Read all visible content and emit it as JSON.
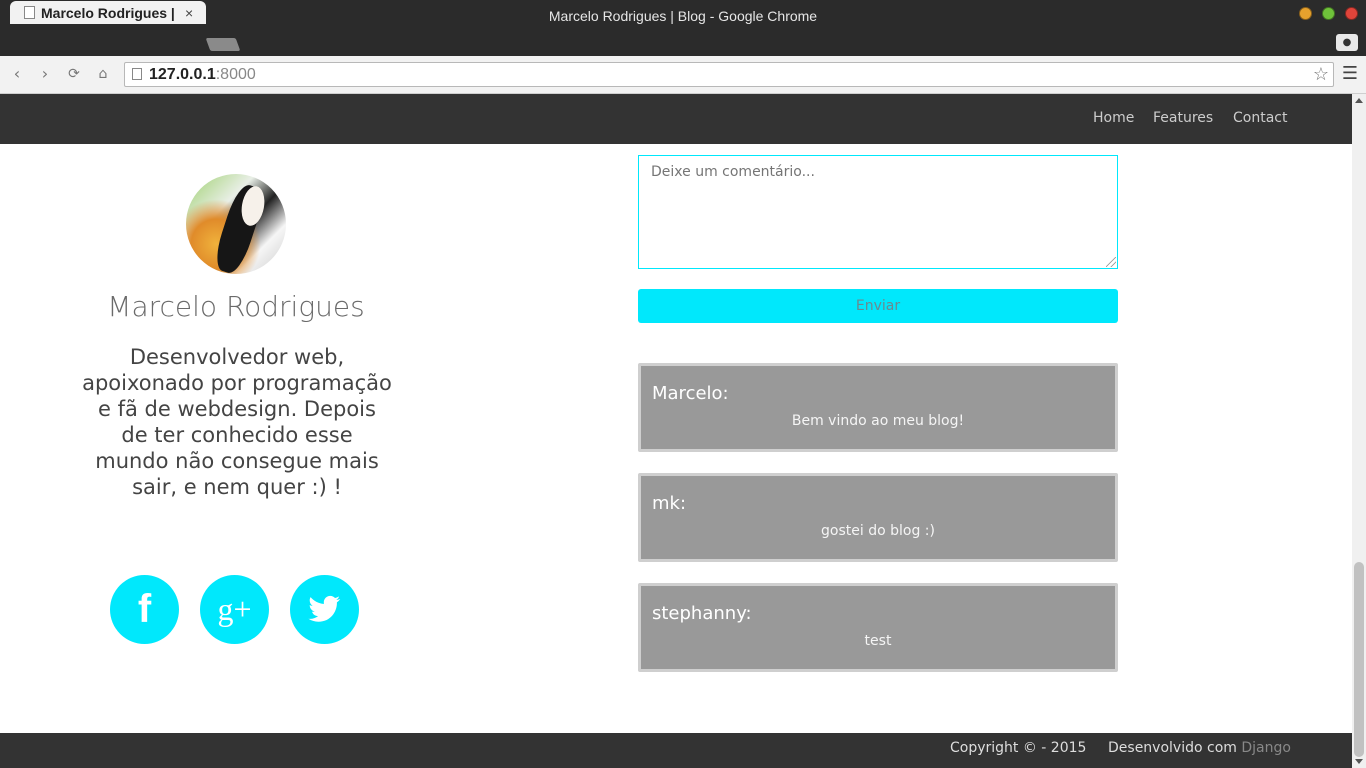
{
  "window": {
    "title": "Marcelo Rodrigues | Blog - Google Chrome"
  },
  "tab": {
    "title": "Marcelo Rodrigues | Blog",
    "close": "×"
  },
  "address_bar": {
    "host": "127.0.0.1",
    "port": ":8000"
  },
  "navbar": {
    "links": [
      "Home",
      "Features",
      "Contact"
    ]
  },
  "profile": {
    "name": "Marcelo Rodrigues",
    "bio": "Desenvolvedor web, apoixonado por programação e fã de webdesign. Depois de ter conhecido esse mundo não consegue mais sair, e nem quer :) !"
  },
  "social": {
    "facebook": "f",
    "googleplus": "g+",
    "icons": [
      "facebook-icon",
      "googleplus-icon",
      "twitter-icon"
    ],
    "accent": "#00e8fc"
  },
  "comment_form": {
    "placeholder": "Deixe um comentário...",
    "value": "",
    "submit_label": "Enviar"
  },
  "comments": [
    {
      "author": "Marcelo:",
      "text": "Bem vindo ao meu blog!"
    },
    {
      "author": "mk:",
      "text": "gostei do blog :)"
    },
    {
      "author": "stephanny:",
      "text": "test"
    }
  ],
  "footer": {
    "copyright": "Copyright © - 2015",
    "developed_by": "Desenvolvido com ",
    "framework": "Django"
  }
}
